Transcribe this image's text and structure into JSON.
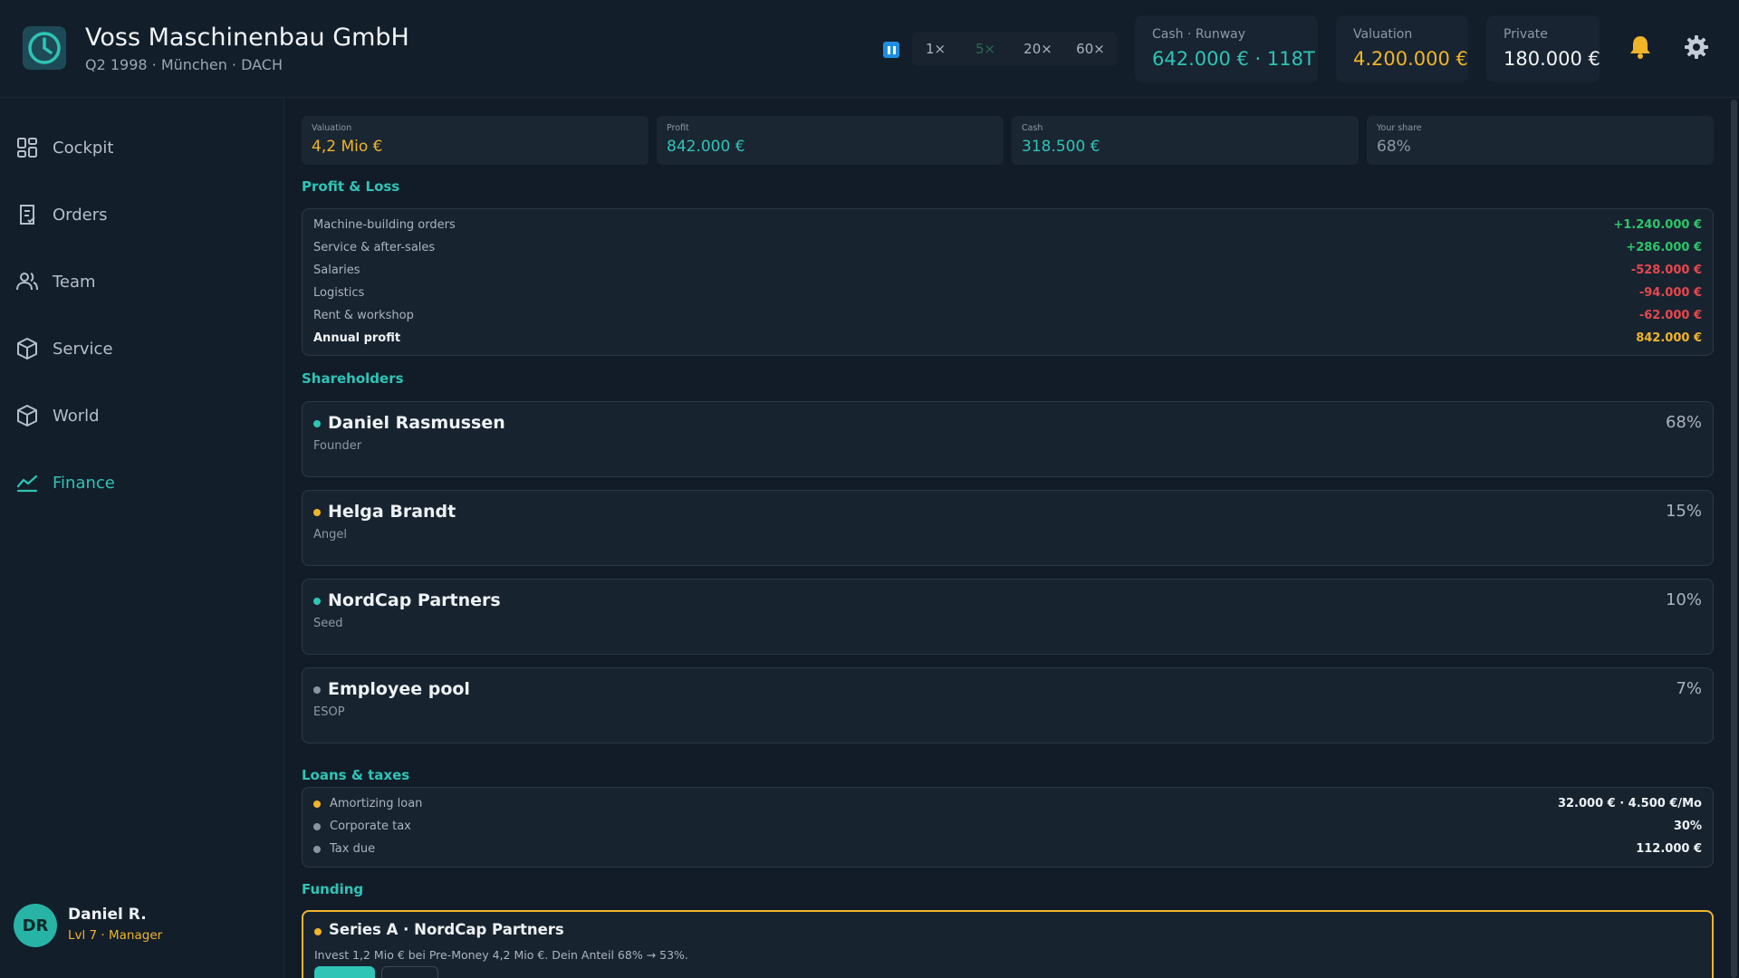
{
  "header": {
    "company_name": "Voss Maschinenbau GmbH",
    "company_sub": "Q2 1998 · München · DACH",
    "speeds": [
      "1×",
      "5×",
      "20×",
      "60×"
    ],
    "cash_runway": {
      "label": "Cash · Runway",
      "value": "642.000 €  ·  118T"
    },
    "valuation": {
      "label": "Valuation",
      "value": "4.200.000 €"
    },
    "private": {
      "label": "Private",
      "value": "180.000 €"
    }
  },
  "sidebar": {
    "items": [
      {
        "label": "Cockpit",
        "icon": "grid-icon"
      },
      {
        "label": "Orders",
        "icon": "clipboard-icon"
      },
      {
        "label": "Team",
        "icon": "users-icon"
      },
      {
        "label": "Service",
        "icon": "box-icon"
      },
      {
        "label": "World",
        "icon": "globe-box-icon"
      },
      {
        "label": "Finance",
        "icon": "chart-line-icon"
      }
    ],
    "user": {
      "initials": "DR",
      "name": "Daniel R.",
      "level": "Lvl 7 · Manager"
    }
  },
  "stats": [
    {
      "label": "Valuation",
      "value": "4,2 Mio €"
    },
    {
      "label": "Profit",
      "value": "842.000 €"
    },
    {
      "label": "Cash",
      "value": "318.500 €"
    },
    {
      "label": "Your share",
      "value": "68%"
    }
  ],
  "pnl": {
    "title": "Profit & Loss",
    "rows": [
      {
        "label": "Machine-building orders",
        "value": "+1.240.000 €"
      },
      {
        "label": "Service & after-sales",
        "value": "+286.000 €"
      },
      {
        "label": "Salaries",
        "value": "-528.000 €"
      },
      {
        "label": "Logistics",
        "value": "-94.000 €"
      },
      {
        "label": "Rent & workshop",
        "value": "-62.000 €"
      },
      {
        "label": "Annual profit",
        "value": "842.000 €"
      }
    ]
  },
  "shareholders": {
    "title": "Shareholders",
    "items": [
      {
        "name": "Daniel Rasmussen",
        "role": "Founder",
        "pct": "68%",
        "color": "#2ec4b6"
      },
      {
        "name": "Helga Brandt",
        "role": "Angel",
        "pct": "15%",
        "color": "#f0b429"
      },
      {
        "name": "NordCap Partners",
        "role": "Seed",
        "pct": "10%",
        "color": "#2ec4b6"
      },
      {
        "name": "Employee pool",
        "role": "ESOP",
        "pct": "7%",
        "color": "#8a95a3"
      }
    ]
  },
  "loans": {
    "title": "Loans & taxes",
    "rows": [
      {
        "label": "Amortizing loan",
        "value": "32.000 € · 4.500 €/Mo",
        "color": "#f0b429"
      },
      {
        "label": "Corporate tax",
        "value": "30%",
        "color": "#8a95a3"
      },
      {
        "label": "Tax due",
        "value": "112.000 €",
        "color": "#8a95a3"
      }
    ]
  },
  "funding": {
    "title": "Funding",
    "offer_title": "Series A · NordCap Partners",
    "offer_desc": "Invest 1,2 Mio € bei Pre-Money 4,2 Mio €. Dein Anteil 68% → 53%."
  },
  "colors": {
    "accent": "#2ec4b6",
    "gold": "#f0b429",
    "positive": "#2ec46a",
    "negative": "#e5484d",
    "pause": "#1d8ee0"
  }
}
